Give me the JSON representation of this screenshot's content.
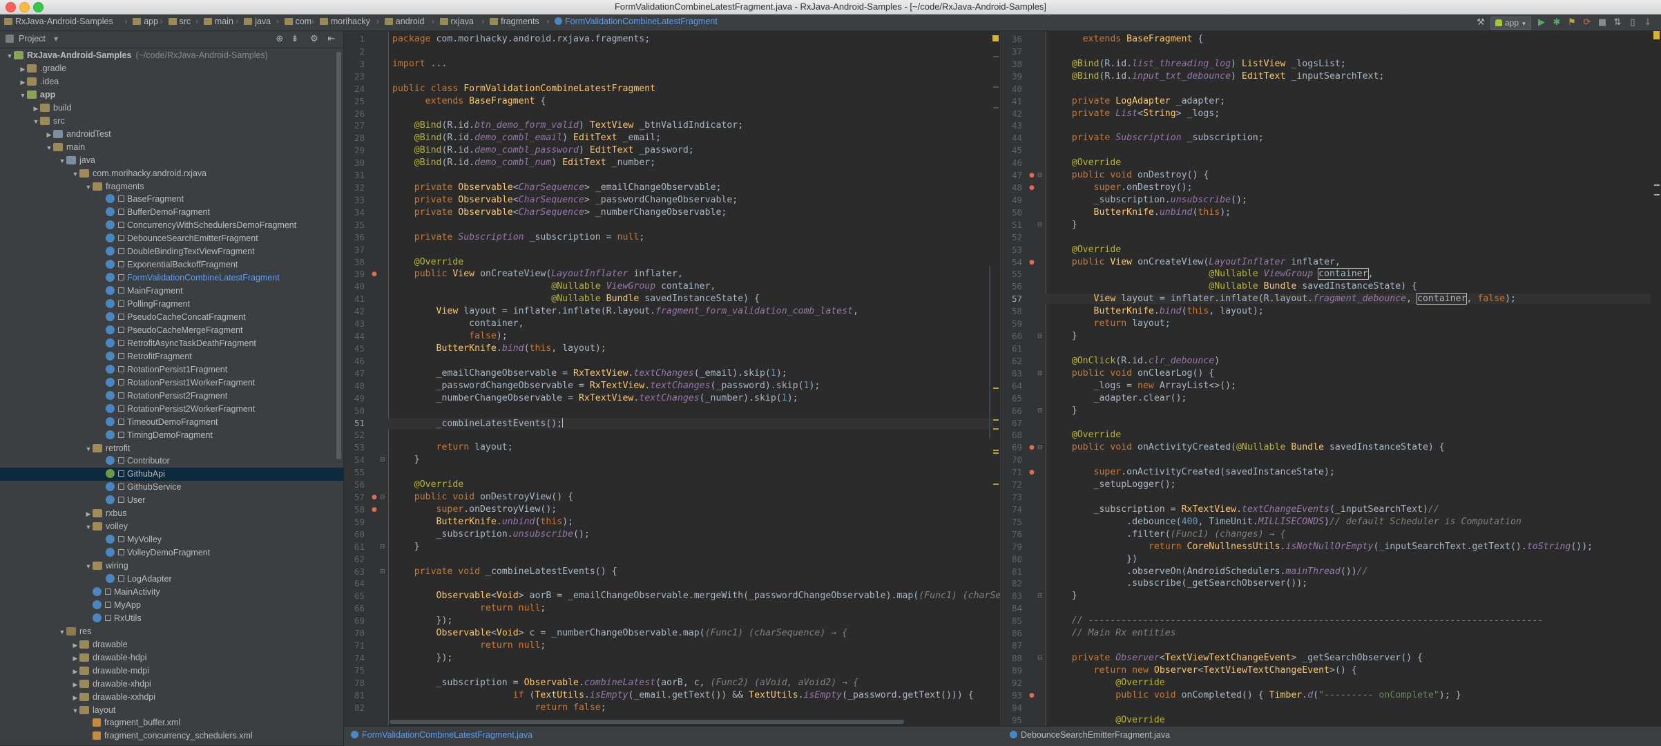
{
  "window": {
    "title": "FormValidationCombineLatestFragment.java - RxJava-Android-Samples - [~/code/RxJava-Android-Samples]"
  },
  "colors": {
    "keyword": "#cc7832",
    "annotation": "#bbb529",
    "string_type": "#ffc66d",
    "field": "#9876aa",
    "comment": "#808080",
    "number": "#6897bb",
    "selection": "#0d293e",
    "link": "#589df6"
  },
  "breadcrumbs": [
    {
      "label": "RxJava-Android-Samples",
      "icon": "folder-icon"
    },
    {
      "label": "app",
      "icon": "folder-icon"
    },
    {
      "label": "src",
      "icon": "folder-icon"
    },
    {
      "label": "main",
      "icon": "folder-icon"
    },
    {
      "label": "java",
      "icon": "folder-icon"
    },
    {
      "label": "com",
      "icon": "folder-icon"
    },
    {
      "label": "morihacky",
      "icon": "folder-icon"
    },
    {
      "label": "android",
      "icon": "folder-icon"
    },
    {
      "label": "rxjava",
      "icon": "folder-icon"
    },
    {
      "label": "fragments",
      "icon": "folder-icon"
    },
    {
      "label": "FormValidationCombineLatestFragment",
      "icon": "class-icon",
      "active": true
    }
  ],
  "toolbar": {
    "run_config": "app"
  },
  "sidebar": {
    "header": "Project",
    "rows": [
      {
        "d": 0,
        "a": "▼",
        "i": "mod",
        "t": "RxJava-Android-Samples",
        "h": "(~/code/RxJava-Android-Samples)"
      },
      {
        "d": 1,
        "a": "▶",
        "i": "folder",
        "t": ".gradle"
      },
      {
        "d": 1,
        "a": "▶",
        "i": "folder",
        "t": ".idea"
      },
      {
        "d": 1,
        "a": "▼",
        "i": "mod",
        "t": "app"
      },
      {
        "d": 2,
        "a": "▶",
        "i": "folder",
        "t": "build"
      },
      {
        "d": 2,
        "a": "▼",
        "i": "folder",
        "t": "src"
      },
      {
        "d": 3,
        "a": "▶",
        "i": "gfolder",
        "t": "androidTest"
      },
      {
        "d": 3,
        "a": "▼",
        "i": "folder",
        "t": "main"
      },
      {
        "d": 4,
        "a": "▼",
        "i": "gfolder",
        "t": "java"
      },
      {
        "d": 5,
        "a": "▼",
        "i": "pkg",
        "t": "com.morihacky.android.rxjava"
      },
      {
        "d": 6,
        "a": "▼",
        "i": "pkg",
        "t": "fragments"
      },
      {
        "d": 7,
        "a": "",
        "i": "class",
        "t": "BaseFragment"
      },
      {
        "d": 7,
        "a": "",
        "i": "class",
        "t": "BufferDemoFragment"
      },
      {
        "d": 7,
        "a": "",
        "i": "class",
        "t": "ConcurrencyWithSchedulersDemoFragment"
      },
      {
        "d": 7,
        "a": "",
        "i": "class",
        "t": "DebounceSearchEmitterFragment"
      },
      {
        "d": 7,
        "a": "",
        "i": "class",
        "t": "DoubleBindingTextViewFragment"
      },
      {
        "d": 7,
        "a": "",
        "i": "class",
        "t": "ExponentialBackoffFragment"
      },
      {
        "d": 7,
        "a": "",
        "i": "class",
        "t": "FormValidationCombineLatestFragment",
        "c": true
      },
      {
        "d": 7,
        "a": "",
        "i": "class",
        "t": "MainFragment"
      },
      {
        "d": 7,
        "a": "",
        "i": "class",
        "t": "PollingFragment"
      },
      {
        "d": 7,
        "a": "",
        "i": "class",
        "t": "PseudoCacheConcatFragment"
      },
      {
        "d": 7,
        "a": "",
        "i": "class",
        "t": "PseudoCacheMergeFragment"
      },
      {
        "d": 7,
        "a": "",
        "i": "class",
        "t": "RetrofitAsyncTaskDeathFragment"
      },
      {
        "d": 7,
        "a": "",
        "i": "class",
        "t": "RetrofitFragment"
      },
      {
        "d": 7,
        "a": "",
        "i": "class",
        "t": "RotationPersist1Fragment"
      },
      {
        "d": 7,
        "a": "",
        "i": "class",
        "t": "RotationPersist1WorkerFragment"
      },
      {
        "d": 7,
        "a": "",
        "i": "class",
        "t": "RotationPersist2Fragment"
      },
      {
        "d": 7,
        "a": "",
        "i": "class",
        "t": "RotationPersist2WorkerFragment"
      },
      {
        "d": 7,
        "a": "",
        "i": "class",
        "t": "TimeoutDemoFragment"
      },
      {
        "d": 7,
        "a": "",
        "i": "class",
        "t": "TimingDemoFragment"
      },
      {
        "d": 6,
        "a": "▼",
        "i": "pkg",
        "t": "retrofit"
      },
      {
        "d": 7,
        "a": "",
        "i": "class",
        "t": "Contributor"
      },
      {
        "d": 7,
        "a": "",
        "i": "iface",
        "t": "GithubApi",
        "s": true
      },
      {
        "d": 7,
        "a": "",
        "i": "class",
        "t": "GithubService"
      },
      {
        "d": 7,
        "a": "",
        "i": "class",
        "t": "User"
      },
      {
        "d": 6,
        "a": "▶",
        "i": "pkg",
        "t": "rxbus"
      },
      {
        "d": 6,
        "a": "▼",
        "i": "pkg",
        "t": "volley"
      },
      {
        "d": 7,
        "a": "",
        "i": "class",
        "t": "MyVolley"
      },
      {
        "d": 7,
        "a": "",
        "i": "class",
        "t": "VolleyDemoFragment"
      },
      {
        "d": 6,
        "a": "▼",
        "i": "pkg",
        "t": "wiring"
      },
      {
        "d": 7,
        "a": "",
        "i": "class",
        "t": "LogAdapter"
      },
      {
        "d": 6,
        "a": "",
        "i": "class",
        "t": "MainActivity"
      },
      {
        "d": 6,
        "a": "",
        "i": "class",
        "t": "MyApp"
      },
      {
        "d": 6,
        "a": "",
        "i": "class",
        "t": "RxUtils"
      },
      {
        "d": 4,
        "a": "▼",
        "i": "res",
        "t": "res"
      },
      {
        "d": 5,
        "a": "▶",
        "i": "folder",
        "t": "drawable"
      },
      {
        "d": 5,
        "a": "▶",
        "i": "folder",
        "t": "drawable-hdpi"
      },
      {
        "d": 5,
        "a": "▶",
        "i": "folder",
        "t": "drawable-mdpi"
      },
      {
        "d": 5,
        "a": "▶",
        "i": "folder",
        "t": "drawable-xhdpi"
      },
      {
        "d": 5,
        "a": "▶",
        "i": "folder",
        "t": "drawable-xxhdpi"
      },
      {
        "d": 5,
        "a": "▼",
        "i": "folder",
        "t": "layout"
      },
      {
        "d": 6,
        "a": "",
        "i": "xml",
        "t": "fragment_buffer.xml"
      },
      {
        "d": 6,
        "a": "",
        "i": "xml",
        "t": "fragment_concurrency_schedulers.xml"
      }
    ]
  },
  "editor_left": {
    "tab": "FormValidationCombineLatestFragment.java",
    "lines": [
      {
        "n": "1",
        "c": "<k>package</k> com.morihacky.android.rxjava.fragments;"
      },
      {
        "n": "2",
        "c": ""
      },
      {
        "n": "3",
        "c": "<k>import</k> ..."
      },
      {
        "n": "23",
        "c": ""
      },
      {
        "n": "24",
        "c": "<k>public class</k> <y>FormValidationCombineLatestFragment</y>"
      },
      {
        "n": "25",
        "c": "      <k>extends</k> <y>BaseFragment</y> {"
      },
      {
        "n": "26",
        "c": ""
      },
      {
        "n": "27",
        "c": "    <a>@Bind</a>(R.id.<i>btn_demo_form_valid</i>) <y>TextView</y> _btnValidIndicator;"
      },
      {
        "n": "28",
        "c": "    <a>@Bind</a>(R.id.<i>demo_combl_email</i>) <y>EditText</y> _email;"
      },
      {
        "n": "29",
        "c": "    <a>@Bind</a>(R.id.<i>demo_combl_password</i>) <y>EditText</y> _password;"
      },
      {
        "n": "30",
        "c": "    <a>@Bind</a>(R.id.<i>demo_combl_num</i>) <y>EditText</y> _number;"
      },
      {
        "n": "31",
        "c": ""
      },
      {
        "n": "32",
        "c": "    <k>private</k> <y>Observable</y>&lt;<i>CharSequence</i>&gt; _emailChangeObservable;"
      },
      {
        "n": "33",
        "c": "    <k>private</k> <y>Observable</y>&lt;<i>CharSequence</i>&gt; _passwordChangeObservable;"
      },
      {
        "n": "34",
        "c": "    <k>private</k> <y>Observable</y>&lt;<i>CharSequence</i>&gt; _numberChangeObservable;"
      },
      {
        "n": "35",
        "c": ""
      },
      {
        "n": "36",
        "c": "    <k>private</k> <i>Subscription</i> _subscription = <k>null</k>;"
      },
      {
        "n": "37",
        "c": ""
      },
      {
        "n": "38",
        "c": "    <a>@Override</a>"
      },
      {
        "n": "39",
        "c": "    <k>public</k> <y>View</y> onCreateView(<i>LayoutInflater</i> inflater,"
      },
      {
        "n": "40",
        "c": "                             <a>@Nullable</a> <i>ViewGroup</i> container,"
      },
      {
        "n": "41",
        "c": "                             <a>@Nullable</a> <y>Bundle</y> savedInstanceState) {"
      },
      {
        "n": "42",
        "c": "        <y>View</y> layout = inflater.inflate(R.layout.<i>fragment_form_validation_comb_latest</i>,"
      },
      {
        "n": "43",
        "c": "              container,"
      },
      {
        "n": "44",
        "c": "              <k>false</k>);"
      },
      {
        "n": "45",
        "c": "        <y>ButterKnife</y>.<i>bind</i>(<k>this</k>, layout);"
      },
      {
        "n": "46",
        "c": ""
      },
      {
        "n": "47",
        "c": "        _emailChangeObservable = <y>RxTextView</y>.<i>textChanges</i>(_email).skip(<n>1</n>);"
      },
      {
        "n": "48",
        "c": "        _passwordChangeObservable = <y>RxTextView</y>.<i>textChanges</i>(_password).skip(<n>1</n>);"
      },
      {
        "n": "49",
        "c": "        _numberChangeObservable = <y>RxTextView</y>.<i>textChanges</i>(_number).skip(<n>1</n>);"
      },
      {
        "n": "50",
        "c": ""
      },
      {
        "n": "51",
        "c": "        _combineLatestEvents();|",
        "cur": true
      },
      {
        "n": "52",
        "c": ""
      },
      {
        "n": "53",
        "c": "        <k>return</k> layout;"
      },
      {
        "n": "54",
        "c": "    }"
      },
      {
        "n": "55",
        "c": ""
      },
      {
        "n": "56",
        "c": "    <a>@Override</a>"
      },
      {
        "n": "57",
        "c": "    <k>public void</k> onDestroyView() {"
      },
      {
        "n": "58",
        "c": "        <k>super</k>.onDestroyView();"
      },
      {
        "n": "59",
        "c": "        <y>ButterKnife</y>.<i>unbind</i>(<k>this</k>);"
      },
      {
        "n": "60",
        "c": "        _subscription.<i>unsubscribe</i>();"
      },
      {
        "n": "61",
        "c": "    }"
      },
      {
        "n": "62",
        "c": ""
      },
      {
        "n": "63",
        "c": "    <k>private void</k> _combineLatestEvents() {"
      },
      {
        "n": "64",
        "c": ""
      },
      {
        "n": "65",
        "c": "        <y>Observable</y>&lt;<y>Void</y>&gt; aorB = _emailChangeObservable.mergeWith(_passwordChangeObservable).map(<g>(Func1) (charSe</g>"
      },
      {
        "n": "66",
        "c": "                <k>return null</k>;"
      },
      {
        "n": "69",
        "c": "        });"
      },
      {
        "n": "70",
        "c": "        <y>Observable</y>&lt;<y>Void</y>&gt; c = _numberChangeObservable.map(<g>(Func1) (charSequence) → {</g>"
      },
      {
        "n": "71",
        "c": "                <k>return null</k>;"
      },
      {
        "n": "74",
        "c": "        });"
      },
      {
        "n": "75",
        "c": ""
      },
      {
        "n": "78",
        "c": "        _subscription = <y>Observable</y>.<i>combineLatest</i>(aorB, c, <g>(Func2) (aVoid, aVoid2) → {</g>"
      },
      {
        "n": "81",
        "c": "                      <k>if</k> (<y>TextUtils</y>.<i>isEmpty</i>(_email.getText()) &amp;&amp; <y>TextUtils</y>.<i>isEmpty</i>(_password.getText())) {"
      },
      {
        "n": "82",
        "c": "                          <k>return false</k>;"
      }
    ]
  },
  "editor_right": {
    "tab": "DebounceSearchEmitterFragment.java",
    "lines": [
      {
        "n": "36",
        "c": "      <k>extends</k> <y>BaseFragment</y> {"
      },
      {
        "n": "37",
        "c": ""
      },
      {
        "n": "38",
        "c": "    <a>@Bind</a>(R.id.<i>list_threading_log</i>) <y>ListView</y> _logsList;"
      },
      {
        "n": "39",
        "c": "    <a>@Bind</a>(R.id.<i>input_txt_debounce</i>) <y>EditText</y> _inputSearchText;"
      },
      {
        "n": "40",
        "c": ""
      },
      {
        "n": "41",
        "c": "    <k>private</k> <y>LogAdapter</y> _adapter;"
      },
      {
        "n": "42",
        "c": "    <k>private</k> <i>List</i>&lt;<y>String</y>&gt; _logs;"
      },
      {
        "n": "43",
        "c": ""
      },
      {
        "n": "44",
        "c": "    <k>private</k> <i>Subscription</i> _subscription;"
      },
      {
        "n": "45",
        "c": ""
      },
      {
        "n": "46",
        "c": "    <a>@Override</a>"
      },
      {
        "n": "47",
        "c": "    <k>public void</k> onDestroy() {"
      },
      {
        "n": "48",
        "c": "        <k>super</k>.onDestroy();"
      },
      {
        "n": "49",
        "c": "        _subscription.<i>unsubscribe</i>();"
      },
      {
        "n": "50",
        "c": "        <y>ButterKnife</y>.<i>unbind</i>(<k>this</k>);"
      },
      {
        "n": "51",
        "c": "    }"
      },
      {
        "n": "52",
        "c": ""
      },
      {
        "n": "53",
        "c": "    <a>@Override</a>"
      },
      {
        "n": "54",
        "c": "    <k>public</k> <y>View</y> onCreateView(<i>LayoutInflater</i> inflater,"
      },
      {
        "n": "55",
        "c": "                             <a>@Nullable</a> <i>ViewGroup</i> <b>container</b>,"
      },
      {
        "n": "56",
        "c": "                             <a>@Nullable</a> <y>Bundle</y> savedInstanceState) {"
      },
      {
        "n": "57",
        "c": "        <y>View</y> layout = inflater.inflate(R.layout.<i>fragment_debounce</i>, <b>container</b>, <k>false</k>);",
        "cur": true
      },
      {
        "n": "58",
        "c": "        <y>ButterKnife</y>.<i>bind</i>(<k>this</k>, layout);"
      },
      {
        "n": "59",
        "c": "        <k>return</k> layout;"
      },
      {
        "n": "60",
        "c": "    }"
      },
      {
        "n": "61",
        "c": ""
      },
      {
        "n": "62",
        "c": "    <a>@OnClick</a>(R.id.<i>clr_debounce</i>)"
      },
      {
        "n": "63",
        "c": "    <k>public void</k> onClearLog() {"
      },
      {
        "n": "64",
        "c": "        _logs = <k>new</k> ArrayList&lt;&gt;();"
      },
      {
        "n": "65",
        "c": "        _adapter.clear();"
      },
      {
        "n": "66",
        "c": "    }"
      },
      {
        "n": "67",
        "c": ""
      },
      {
        "n": "68",
        "c": "    <a>@Override</a>"
      },
      {
        "n": "69",
        "c": "    <k>public void</k> onActivityCreated(<a>@Nullable</a> <y>Bundle</y> savedInstanceState) {"
      },
      {
        "n": "70",
        "c": ""
      },
      {
        "n": "71",
        "c": "        <k>super</k>.onActivityCreated(savedInstanceState);"
      },
      {
        "n": "72",
        "c": "        _setupLogger();"
      },
      {
        "n": "73",
        "c": ""
      },
      {
        "n": "74",
        "c": "        _subscription = <y>RxTextView</y>.<i>textChangeEvents</i>(_inputSearchText)<g>//</g>"
      },
      {
        "n": "75",
        "c": "              .debounce(<n>400</n>, TimeUnit.<i>MILLISECONDS</i>)<g>// default Scheduler is Computation</g>"
      },
      {
        "n": "76",
        "c": "              .filter(<g>(Func1) (changes) → {</g>"
      },
      {
        "n": "79",
        "c": "                  <k>return</k> <y>CoreNullnessUtils</y>.<i>isNotNullOrEmpty</i>(_inputSearchText.getText().<i>toString</i>());"
      },
      {
        "n": "80",
        "c": "              })"
      },
      {
        "n": "81",
        "c": "              .observeOn(AndroidSchedulers.<i>mainThread</i>())<g>//</g>"
      },
      {
        "n": "82",
        "c": "              .subscribe(_getSearchObserver());"
      },
      {
        "n": "83",
        "c": "    }"
      },
      {
        "n": "84",
        "c": ""
      },
      {
        "n": "85",
        "c": "    <g>// -----------------------------------------------------------------------------------</g>"
      },
      {
        "n": "86",
        "c": "    <g>// Main Rx entities</g>"
      },
      {
        "n": "87",
        "c": ""
      },
      {
        "n": "88",
        "c": "    <k>private</k> <i>Observer</i>&lt;<y>TextViewTextChangeEvent</y>&gt; _getSearchObserver() {"
      },
      {
        "n": "89",
        "c": "        <k>return new</k> <y>Observer</y>&lt;<y>TextViewTextChangeEvent</y>&gt;() {"
      },
      {
        "n": "92",
        "c": "            <a>@Override</a>"
      },
      {
        "n": "93",
        "c": "            <k>public void</k> onCompleted() { <y>Timber</y>.<i>d</i>(<s>\"--------- onComplete\"</s>); }"
      },
      {
        "n": "94",
        "c": ""
      },
      {
        "n": "95",
        "c": "            <a>@Override</a>"
      }
    ]
  }
}
